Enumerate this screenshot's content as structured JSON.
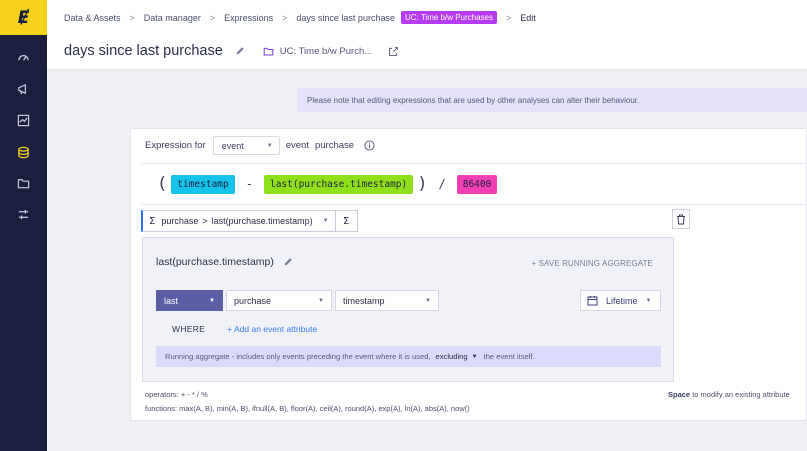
{
  "app": {
    "logo_glyph": "Ɇ",
    "brand_color": "#f7d21a",
    "sidebar_bg": "#1c1e3e"
  },
  "sidebar": {
    "items": [
      {
        "icon": "gauge-icon"
      },
      {
        "icon": "megaphone-icon"
      },
      {
        "icon": "chart-icon"
      },
      {
        "icon": "database-icon",
        "active": true
      },
      {
        "icon": "folder-icon"
      },
      {
        "icon": "sliders-icon"
      }
    ]
  },
  "breadcrumb": {
    "items": [
      "Data & Assets",
      "Data manager",
      "Expressions",
      "days since last purchase"
    ],
    "tag": "UC: Time b/w Purchases",
    "current": "Edit",
    "separator": ">"
  },
  "header": {
    "title": "days since last purchase",
    "folder_label": "UC: Time b/w Purch..."
  },
  "notice": {
    "text": "Please note that editing expressions that are used by other analyses can alter their behaviour."
  },
  "expression": {
    "expression_for_label": "Expression for",
    "type_value": "event",
    "event_label": "event",
    "event_name": "purchase",
    "formula": {
      "open_paren": "(",
      "token1": "timestamp",
      "minus": "-",
      "token2": "last(purchase.timestamp)",
      "close_paren": ")",
      "divide": "/",
      "token3": "86400"
    },
    "path": {
      "part1": "purchase",
      "separator": ">",
      "part2": "last(purchase.timestamp)"
    },
    "sigma": "Σ"
  },
  "aggregate": {
    "title": "last(purchase.timestamp)",
    "save_label": "+ SAVE RUNNING AGGREGATE",
    "function": "last",
    "event": "purchase",
    "attribute": "timestamp",
    "period": "Lifetime",
    "where_label": "WHERE",
    "add_attribute": "+ Add an event attribute",
    "note_prefix": "Running aggregate - includes only events preceding the event where it is used,",
    "note_dropdown": "excluding",
    "note_suffix": "the event itself."
  },
  "footer": {
    "operators": "operators: + - * / %",
    "functions": "functions: max(A, B), min(A, B), ifnull(A, B), floor(A), ceil(A), round(A), exp(A), ln(A), abs(A), now()",
    "hint_key": "Space",
    "hint_text": "to modify an existing attribute"
  }
}
